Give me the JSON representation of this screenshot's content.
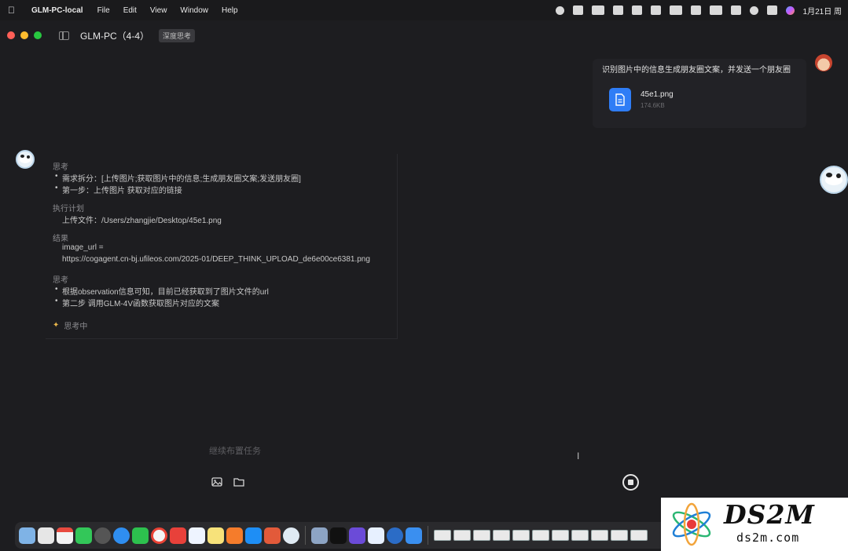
{
  "menubar": {
    "app_name": "GLM-PC-local",
    "menus": [
      "File",
      "Edit",
      "View",
      "Window",
      "Help"
    ],
    "date_time": "1月21日 周"
  },
  "window": {
    "title": "GLM-PC（4-4）",
    "mode_chip": "深度思考"
  },
  "user_message": {
    "text": "识别图片中的信息生成朋友圈文案，并发送一个朋友圈",
    "attachment": {
      "name": "45e1.png",
      "size": "174.6KB"
    }
  },
  "assistant": {
    "sections": [
      {
        "label": "思考",
        "bullets": [
          "需求拆分：[上传图片;获取图片中的信息;生成朋友圈文案;发送朋友圈]",
          "第一步：上传图片 获取对应的链接"
        ]
      },
      {
        "label": "执行计划",
        "lines": [
          "上传文件：/Users/zhangjie/Desktop/45e1.png"
        ]
      },
      {
        "label": "结果",
        "lines": [
          "image_url =",
          "https://cogagent.cn-bj.ufileos.com/2025-01/DEEP_THINK_UPLOAD_de6e00ce6381.png"
        ]
      },
      {
        "label": "思考",
        "bullets": [
          "根据observation信息可知，目前已经获取到了图片文件的url",
          "第二步 调用GLM-4V函数获取图片对应的文案"
        ]
      }
    ],
    "status": "思考中"
  },
  "input": {
    "placeholder": "继续布置任务"
  },
  "watermark": {
    "brand": "DS2M",
    "domain": "ds2m.com"
  }
}
